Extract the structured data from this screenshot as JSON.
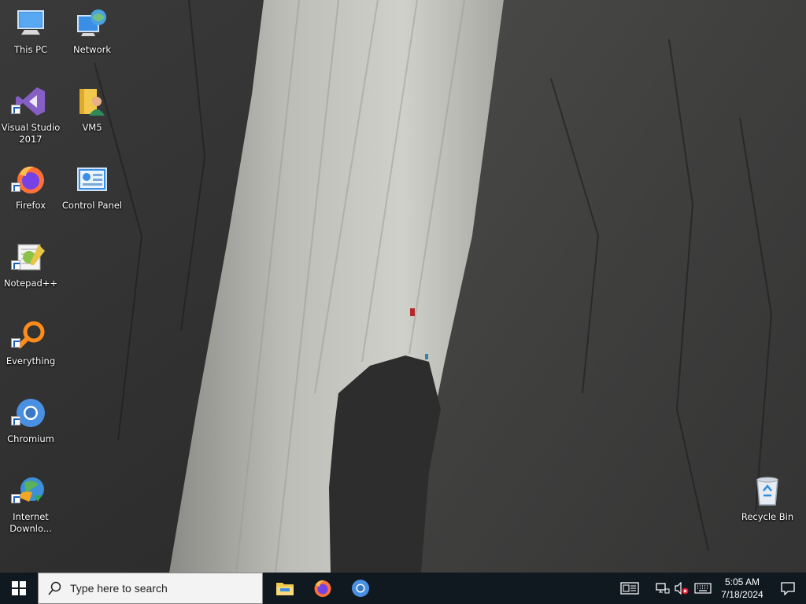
{
  "desktop": {
    "icons": [
      {
        "label": "This PC",
        "icon": "computer-icon",
        "shortcut": false
      },
      {
        "label": "Network",
        "icon": "network-icon",
        "shortcut": false
      },
      {
        "label": "Visual Studio 2017",
        "icon": "visual-studio-icon",
        "shortcut": true
      },
      {
        "label": "VM5",
        "icon": "user-folder-icon",
        "shortcut": false
      },
      {
        "label": "Firefox",
        "icon": "firefox-icon",
        "shortcut": true
      },
      {
        "label": "Control Panel",
        "icon": "control-panel-icon",
        "shortcut": false
      },
      {
        "label": "Notepad++",
        "icon": "notepad-plus-plus-icon",
        "shortcut": true
      },
      {
        "label": "Everything",
        "icon": "everything-search-icon",
        "shortcut": true
      },
      {
        "label": "Chromium",
        "icon": "chromium-icon",
        "shortcut": true
      },
      {
        "label": "Internet Downlo...",
        "icon": "internet-download-manager-icon",
        "shortcut": true
      },
      {
        "label": "Recycle Bin",
        "icon": "recycle-bin-icon",
        "shortcut": false
      }
    ]
  },
  "taskbar": {
    "search_placeholder": "Type here to search",
    "pinned": [
      "file-explorer-icon",
      "firefox-icon",
      "chromium-icon"
    ],
    "tray": [
      "news-widget-icon",
      "network-icon",
      "speaker-muted-icon",
      "touch-keyboard-icon"
    ],
    "time": "5:05 AM",
    "date": "7/18/2024"
  },
  "colors": {
    "taskbar_bg": "#101820",
    "search_bg": "#f3f3f3",
    "accent": "#0078d7"
  }
}
